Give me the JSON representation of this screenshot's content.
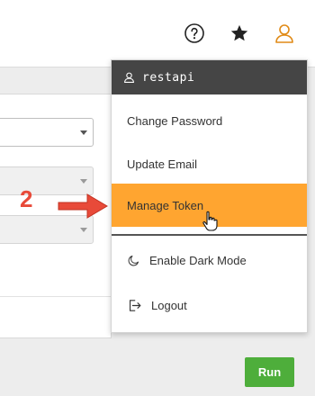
{
  "header": {
    "icons": [
      "help-icon",
      "star-icon",
      "user-icon"
    ]
  },
  "menu": {
    "username": "restapi",
    "items": [
      {
        "label": "Change Password"
      },
      {
        "label": "Update Email"
      },
      {
        "label": "Manage Token",
        "highlighted": true
      },
      {
        "label": "Enable Dark Mode",
        "icon": "moon-icon"
      },
      {
        "label": "Logout",
        "icon": "logout-icon"
      }
    ]
  },
  "annotation": {
    "step": "2"
  },
  "run_button": {
    "label": "Run"
  },
  "colors": {
    "highlight": "#ffa530",
    "menu_header": "#454545",
    "run_button": "#4eae3b",
    "user_icon": "#e08a16",
    "annotation": "#e84a39"
  }
}
